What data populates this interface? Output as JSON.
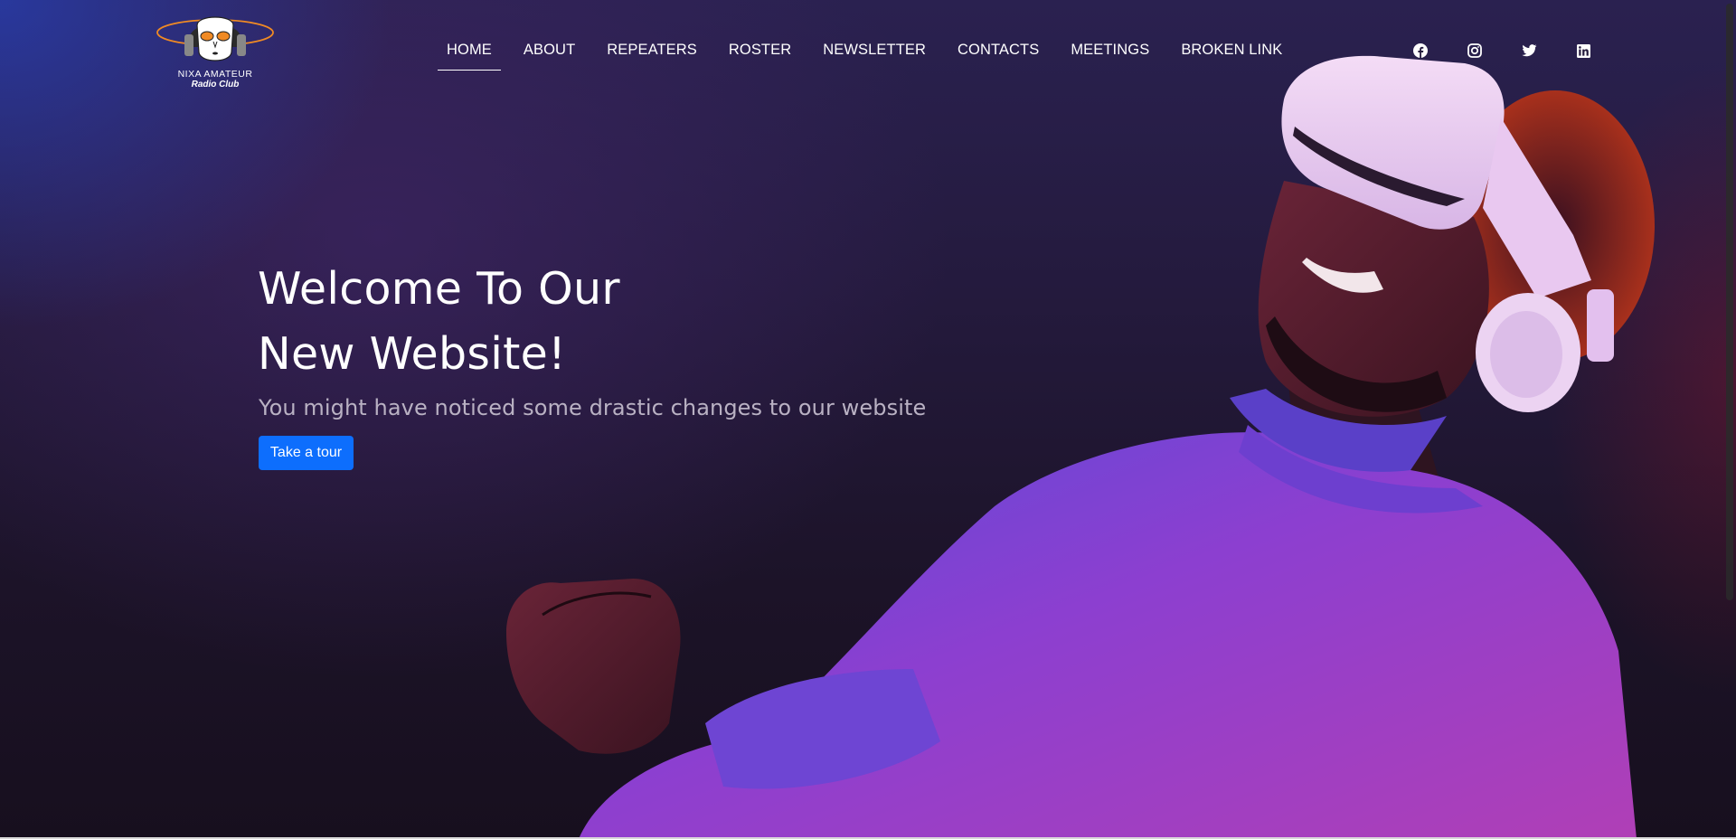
{
  "logo": {
    "line1": "NIXA AMATEUR",
    "line2": "Radio Club"
  },
  "nav": {
    "items": [
      {
        "label": "HOME",
        "active": true
      },
      {
        "label": "ABOUT"
      },
      {
        "label": "REPEATERS"
      },
      {
        "label": "ROSTER"
      },
      {
        "label": "NEWSLETTER"
      },
      {
        "label": "CONTACTS"
      },
      {
        "label": "MEETINGS"
      },
      {
        "label": "BROKEN LINK"
      }
    ]
  },
  "social": {
    "icons": [
      "facebook-icon",
      "instagram-icon",
      "twitter-icon",
      "linkedin-icon"
    ]
  },
  "hero": {
    "title_line1": "Welcome To Our",
    "title_line2": "New Website!",
    "subtitle": "You might have noticed some drastic changes to our website",
    "button_label": "Take a tour"
  },
  "colors": {
    "button": "#0d6efd",
    "accent_purple": "#8a3fd6",
    "logo_orange": "#f08a24"
  }
}
